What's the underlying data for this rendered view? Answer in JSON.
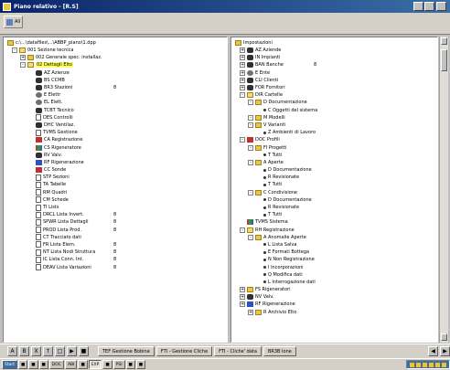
{
  "window": {
    "title": "Piano relativo - [R.S]"
  },
  "toolbar": {
    "save_label": "All"
  },
  "left_pane": {
    "path": "c:\\...\\datafiles\\...\\ABBP_piano\\1.dpp",
    "rows": [
      {
        "indent": 1,
        "exp": "-",
        "icon": "folder-open",
        "label": "001 Sezione tecnica",
        "count": ""
      },
      {
        "indent": 2,
        "exp": "+",
        "icon": "folder",
        "label": "002 Generale spec. installaz.",
        "count": ""
      },
      {
        "indent": 2,
        "exp": "-",
        "icon": "folder-open",
        "label": "02 Dettagli Elto",
        "count": "",
        "highlight": true
      },
      {
        "indent": 3,
        "exp": "",
        "icon": "tool",
        "label": "AZ Azienze",
        "count": ""
      },
      {
        "indent": 3,
        "exp": "",
        "icon": "tool",
        "label": "BS CCMB",
        "count": ""
      },
      {
        "indent": 3,
        "exp": "",
        "icon": "tool",
        "label": "BR3 Stazioni",
        "count": "8"
      },
      {
        "indent": 3,
        "exp": "",
        "icon": "gear",
        "label": "E Elettr",
        "count": ""
      },
      {
        "indent": 3,
        "exp": "",
        "icon": "gear",
        "label": "EL Elett.",
        "count": ""
      },
      {
        "indent": 3,
        "exp": "",
        "icon": "tool",
        "label": "TCBT Tecnico",
        "count": ""
      },
      {
        "indent": 3,
        "exp": "",
        "icon": "doc",
        "label": "DES Controlli",
        "count": ""
      },
      {
        "indent": 3,
        "exp": "",
        "icon": "tool",
        "label": "DHC Ventilaz.",
        "count": ""
      },
      {
        "indent": 3,
        "exp": "",
        "icon": "doc",
        "label": "TVMS Gestione",
        "count": ""
      },
      {
        "indent": 3,
        "exp": "",
        "icon": "red",
        "label": "CA Registrazione",
        "count": ""
      },
      {
        "indent": 3,
        "exp": "",
        "icon": "multi",
        "label": "CS Rigeneratore",
        "count": ""
      },
      {
        "indent": 3,
        "exp": "",
        "icon": "tool",
        "label": "RV Valv.",
        "count": ""
      },
      {
        "indent": 3,
        "exp": "",
        "icon": "blue",
        "label": "RF Rigenerazione",
        "count": ""
      },
      {
        "indent": 3,
        "exp": "",
        "icon": "red",
        "label": "CC Sonde",
        "count": ""
      },
      {
        "indent": 3,
        "exp": "",
        "icon": "doc",
        "label": "STP Sezioni",
        "count": ""
      },
      {
        "indent": 3,
        "exp": "",
        "icon": "doc",
        "label": "TA Tabelle",
        "count": ""
      },
      {
        "indent": 3,
        "exp": "",
        "icon": "doc",
        "label": "RM Quadri",
        "count": ""
      },
      {
        "indent": 3,
        "exp": "",
        "icon": "doc",
        "label": "CM Schede",
        "count": ""
      },
      {
        "indent": 3,
        "exp": "",
        "icon": "doc",
        "label": "TI Lists",
        "count": ""
      },
      {
        "indent": 3,
        "exp": "",
        "icon": "doc",
        "label": "DRCL Lista Invert.",
        "count": "8"
      },
      {
        "indent": 3,
        "exp": "",
        "icon": "doc",
        "label": "SPWR Lista Dettagli",
        "count": "8"
      },
      {
        "indent": 3,
        "exp": "",
        "icon": "doc",
        "label": "PROD Lista Prod.",
        "count": "8"
      },
      {
        "indent": 3,
        "exp": "",
        "icon": "doc",
        "label": "CT Tracciato dati",
        "count": ""
      },
      {
        "indent": 3,
        "exp": "",
        "icon": "doc",
        "label": "FR Lista Elem.",
        "count": "8"
      },
      {
        "indent": 3,
        "exp": "",
        "icon": "doc",
        "label": "NT Lista Nodi Struttura",
        "count": "8"
      },
      {
        "indent": 3,
        "exp": "",
        "icon": "doc",
        "label": "IC Lista Conn. Int.",
        "count": "8"
      },
      {
        "indent": 3,
        "exp": "",
        "icon": "doc",
        "label": "DEAV Lista Variazioni",
        "count": "8"
      }
    ]
  },
  "right_pane": {
    "path": "Impostazioni",
    "rows": [
      {
        "indent": 1,
        "exp": "+",
        "icon": "tool",
        "label": "AZ Aziende",
        "count": ""
      },
      {
        "indent": 1,
        "exp": "+",
        "icon": "tool",
        "label": "IN Impianti",
        "count": ""
      },
      {
        "indent": 1,
        "exp": "+",
        "icon": "tool",
        "label": "BAN Banche",
        "count": "8"
      },
      {
        "indent": 1,
        "exp": "+",
        "icon": "gear",
        "label": "E Ente",
        "count": ""
      },
      {
        "indent": 1,
        "exp": "+",
        "icon": "tool",
        "label": "CLI Clienti",
        "count": ""
      },
      {
        "indent": 1,
        "exp": "+",
        "icon": "tool",
        "label": "FOR Fornitori",
        "count": ""
      },
      {
        "indent": 1,
        "exp": "-",
        "icon": "folder-open",
        "label": "DIR Cartelle",
        "count": ""
      },
      {
        "indent": 2,
        "exp": "-",
        "icon": "folder",
        "label": "D Documentazione",
        "count": ""
      },
      {
        "indent": 3,
        "exp": "",
        "icon": "bullet",
        "label": "C Oggetti del sistema",
        "count": ""
      },
      {
        "indent": 2,
        "exp": "-",
        "icon": "folder",
        "label": "M Modelli",
        "count": ""
      },
      {
        "indent": 2,
        "exp": "-",
        "icon": "folder",
        "label": "V Varianti",
        "count": ""
      },
      {
        "indent": 3,
        "exp": "",
        "icon": "bullet",
        "label": "Z Ambienti di Lavoro",
        "count": ""
      },
      {
        "indent": 1,
        "exp": "-",
        "icon": "red",
        "label": "DOC Profili",
        "count": ""
      },
      {
        "indent": 2,
        "exp": "-",
        "icon": "folder",
        "label": "FI Progetti",
        "count": ""
      },
      {
        "indent": 3,
        "exp": "",
        "icon": "bullet",
        "label": "T Tutti",
        "count": ""
      },
      {
        "indent": 2,
        "exp": "-",
        "icon": "folder",
        "label": "A Aperte",
        "count": ""
      },
      {
        "indent": 3,
        "exp": "",
        "icon": "bullet",
        "label": "D Documentazione",
        "count": ""
      },
      {
        "indent": 3,
        "exp": "",
        "icon": "bullet",
        "label": "R Revisionate",
        "count": ""
      },
      {
        "indent": 3,
        "exp": "",
        "icon": "bullet",
        "label": "T Tutti",
        "count": ""
      },
      {
        "indent": 2,
        "exp": "-",
        "icon": "folder",
        "label": "C Condivisione",
        "count": ""
      },
      {
        "indent": 3,
        "exp": "",
        "icon": "bullet",
        "label": "D Documentazione",
        "count": ""
      },
      {
        "indent": 3,
        "exp": "",
        "icon": "bullet",
        "label": "R Revisionate",
        "count": ""
      },
      {
        "indent": 3,
        "exp": "",
        "icon": "bullet",
        "label": "T Tutti",
        "count": ""
      },
      {
        "indent": 1,
        "exp": "",
        "icon": "multi",
        "label": "TVMS Sistema",
        "count": ""
      },
      {
        "indent": 1,
        "exp": "-",
        "icon": "folder-open",
        "label": "RH Registrazione",
        "count": ""
      },
      {
        "indent": 2,
        "exp": "-",
        "icon": "folder",
        "label": "A Anomalie Aperte",
        "count": ""
      },
      {
        "indent": 3,
        "exp": "",
        "icon": "bullet",
        "label": "L Lista Salva",
        "count": ""
      },
      {
        "indent": 3,
        "exp": "",
        "icon": "bullet",
        "label": "E Formati Bottega",
        "count": ""
      },
      {
        "indent": 3,
        "exp": "",
        "icon": "bullet",
        "label": "N Non Registrazione",
        "count": ""
      },
      {
        "indent": 3,
        "exp": "",
        "icon": "bullet",
        "label": "I Incorporazioni",
        "count": ""
      },
      {
        "indent": 3,
        "exp": "",
        "icon": "bullet",
        "label": "Q Modifica dati",
        "count": ""
      },
      {
        "indent": 3,
        "exp": "",
        "icon": "bullet",
        "label": "L Interrogazione dati",
        "count": ""
      },
      {
        "indent": 1,
        "exp": "+",
        "icon": "folder",
        "label": "FS Rigeneratori",
        "count": ""
      },
      {
        "indent": 1,
        "exp": "+",
        "icon": "tool",
        "label": "NV Valv.",
        "count": ""
      },
      {
        "indent": 1,
        "exp": "+",
        "icon": "blue",
        "label": "RF Rigenerazione",
        "count": ""
      },
      {
        "indent": 2,
        "exp": "+",
        "icon": "folder",
        "label": "R Archivio Elto",
        "count": ""
      }
    ]
  },
  "bottom_bar": {
    "buttons": [
      "A",
      "B",
      "X",
      "↑",
      "□",
      "▶",
      "■"
    ],
    "tabs": [
      "TEF Gestione Bobine",
      "FTI - Gestione Cliche",
      "FTI - Cliche' data",
      "BR3B Ione"
    ],
    "nav": [
      "◀",
      "▶"
    ]
  },
  "taskbar": {
    "start": "Start",
    "items": [
      "■",
      "■",
      "■",
      "DOC",
      "ABI",
      "■",
      "EXP",
      "■",
      "PSI",
      "■",
      "■"
    ],
    "time": ""
  },
  "colors": {
    "titlebar": "#0a246a",
    "highlight": "#ffff60",
    "folder": "#e8c840"
  }
}
